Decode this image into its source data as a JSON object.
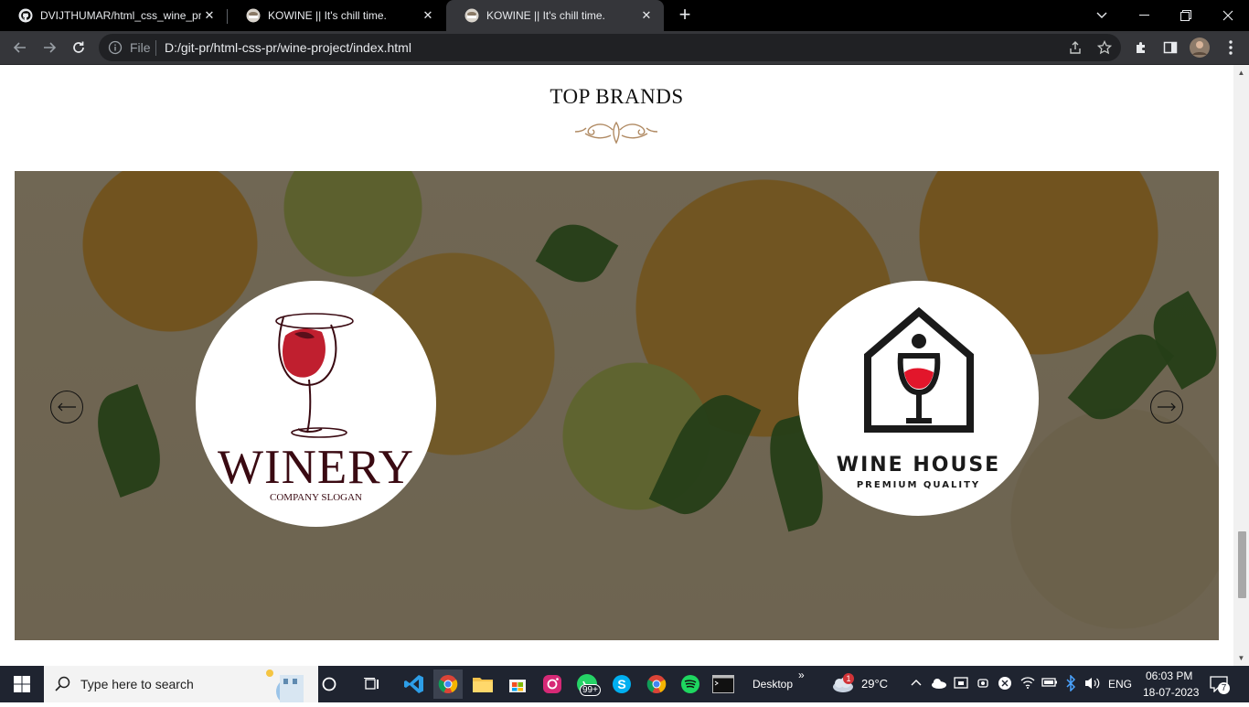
{
  "browser": {
    "tabs": [
      {
        "title": "DVIJTHUMAR/html_css_wine_pro",
        "icon": "github-icon",
        "close": "✕",
        "active": false
      },
      {
        "title": "KOWINE || It's chill time.",
        "icon": "wine-site-icon",
        "close": "✕",
        "active": false
      },
      {
        "title": "KOWINE || It's chill time.",
        "icon": "wine-site-icon",
        "close": "✕",
        "active": true
      }
    ],
    "new_tab": "+",
    "omnibox": {
      "scheme_label": "File",
      "url": "D:/git-pr/html-css-pr/wine-project/index.html"
    }
  },
  "page": {
    "section_title": "TOP BRANDS",
    "brands": [
      {
        "name": "WINERY",
        "slogan": "COMPANY SLOGAN",
        "icon": "wine-glass-pour-icon"
      },
      {
        "name": "WINE HOUSE",
        "slogan": "PREMIUM QUALITY",
        "icon": "house-wine-glass-icon"
      }
    ],
    "colors": {
      "ornament": "#b08a63",
      "winery_text": "#3a0a12",
      "wine_red": "#c01f2f",
      "house_black": "#1a1a1a"
    }
  },
  "taskbar": {
    "search_placeholder": "Type here to search",
    "whatsapp_badge": "99+",
    "desktop_label": "Desktop",
    "weather": {
      "temp": "29°C",
      "badge": "1"
    },
    "language": "ENG",
    "time": "06:03 PM",
    "date": "18-07-2023",
    "notifications": "7"
  }
}
